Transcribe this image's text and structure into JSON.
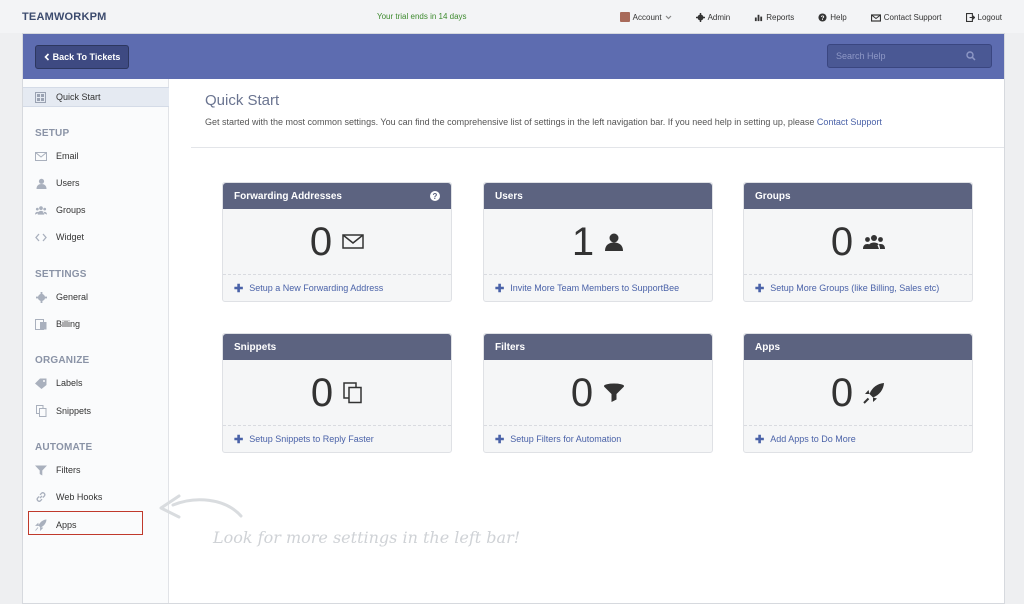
{
  "topbar": {
    "brand": "TEAMWORKPM",
    "trial": "Your trial ends in 14 days",
    "nav": [
      {
        "label": "Account",
        "icon": "avatar"
      },
      {
        "label": "Admin",
        "icon": "gear-icon"
      },
      {
        "label": "Reports",
        "icon": "bar-chart-icon"
      },
      {
        "label": "Help",
        "icon": "question-icon"
      },
      {
        "label": "Contact Support",
        "icon": "support-icon"
      },
      {
        "label": "Logout",
        "icon": "logout-icon"
      }
    ]
  },
  "header": {
    "back_label": "Back To Tickets",
    "search_placeholder": "Search Help"
  },
  "sidebar": {
    "quick_start": "Quick Start",
    "sections": [
      {
        "title": "SETUP",
        "items": [
          {
            "label": "Email"
          },
          {
            "label": "Users"
          },
          {
            "label": "Groups"
          },
          {
            "label": "Widget"
          }
        ]
      },
      {
        "title": "SETTINGS",
        "items": [
          {
            "label": "General"
          },
          {
            "label": "Billing"
          }
        ]
      },
      {
        "title": "ORGANIZE",
        "items": [
          {
            "label": "Labels"
          },
          {
            "label": "Snippets"
          }
        ]
      },
      {
        "title": "AUTOMATE",
        "items": [
          {
            "label": "Filters"
          },
          {
            "label": "Web Hooks"
          },
          {
            "label": "Apps"
          }
        ]
      }
    ]
  },
  "main": {
    "title": "Quick Start",
    "intro": "Get started with the most common settings. You can find the comprehensive list of settings in the left navigation bar. If you need help in setting up, please ",
    "intro_link": "Contact Support",
    "cards": [
      {
        "title": "Forwarding Addresses",
        "count": "0",
        "action": "Setup a New Forwarding Address"
      },
      {
        "title": "Users",
        "count": "1",
        "action": "Invite More Team Members to SupportBee"
      },
      {
        "title": "Groups",
        "count": "0",
        "action": "Setup More Groups (like Billing, Sales etc)"
      },
      {
        "title": "Snippets",
        "count": "0",
        "action": "Setup Snippets to Reply Faster"
      },
      {
        "title": "Filters",
        "count": "0",
        "action": "Setup Filters for Automation"
      },
      {
        "title": "Apps",
        "count": "0",
        "action": "Add Apps to Do More"
      }
    ],
    "note": "Look for more settings in the left bar!"
  },
  "colors": {
    "header_bg": "#5d6cb0",
    "card_header": "#5c6380",
    "link": "#4a62a8",
    "trial": "#3d8a2e",
    "highlight": "#c0392b"
  }
}
